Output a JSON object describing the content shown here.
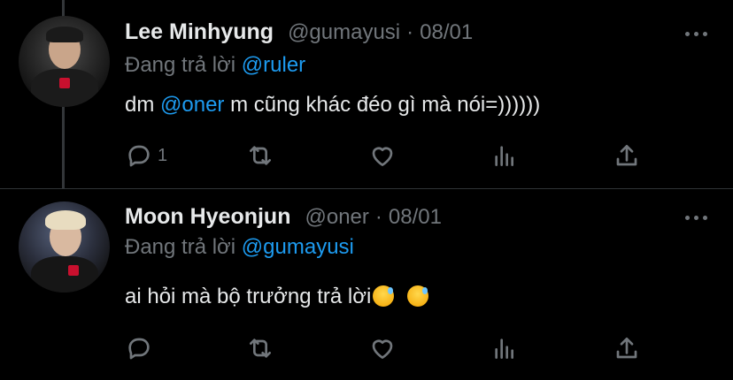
{
  "tweets": [
    {
      "name": "Lee Minhyung",
      "handle": "@gumayusi",
      "separator": "·",
      "date": "08/01",
      "reply_prefix": "Đang trả lời",
      "reply_to": "@ruler",
      "text_before": "dm ",
      "text_mention": "@oner",
      "text_after": " m cũng khác đéo gì mà nói=))))))",
      "reply_count": "1"
    },
    {
      "name": "Moon Hyeonjun",
      "handle": "@oner",
      "separator": "·",
      "date": "08/01",
      "reply_prefix": "Đang trả lời",
      "reply_to": "@gumayusi",
      "text": "ai hỏi mà bộ trưởng trả lời",
      "emojis": [
        "sweat-smile-emoji",
        "sweat-smile-emoji"
      ],
      "reply_count": ""
    }
  ],
  "colors": {
    "background": "#000000",
    "text": "#e7e9ea",
    "muted": "#71767b",
    "accent": "#1d9bf0"
  }
}
